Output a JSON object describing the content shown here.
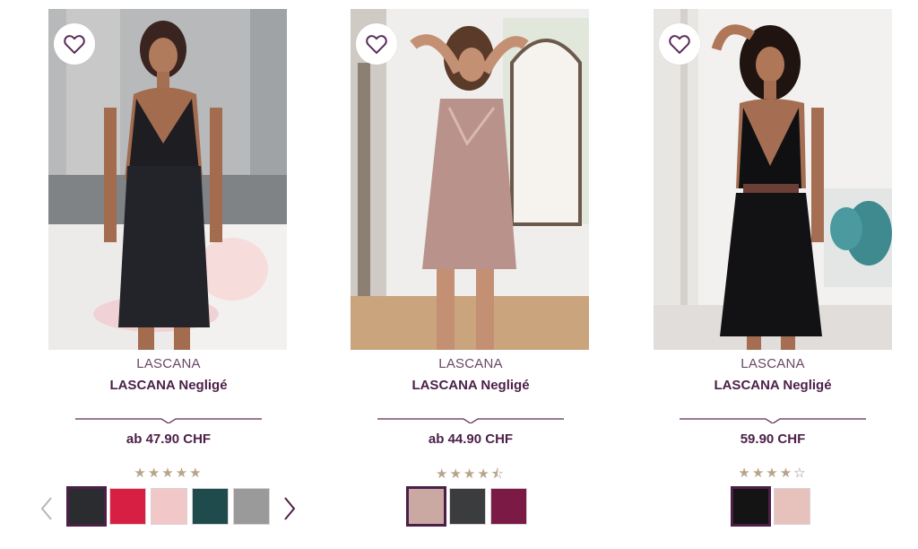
{
  "products": [
    {
      "brand": "LASCANA",
      "title": "LASCANA Negligé",
      "price": "ab 47.90 CHF",
      "rating_stars": "★★★★★",
      "rating_empty": "",
      "swatches": [
        "#2b2c30",
        "#d61f43",
        "#f1c7c7",
        "#1f4b4c",
        "#9a9a9a"
      ],
      "selected_swatch": 0,
      "has_prev_arrow": true,
      "has_next_arrow": true
    },
    {
      "brand": "LASCANA",
      "title": "LASCANA Negligé",
      "price": "ab 44.90 CHF",
      "rating_stars": "★★★★⯪",
      "rating_empty": "",
      "swatches": [
        "#c9a9a2",
        "#3b3c3e",
        "#7b1a45"
      ],
      "selected_swatch": 0
    },
    {
      "brand": "LASCANA",
      "title": "LASCANA Negligé",
      "price": "59.90 CHF",
      "rating_stars": "★★★★",
      "rating_empty": "☆",
      "swatches": [
        "#141414",
        "#e7c2bd"
      ],
      "selected_swatch": 0
    }
  ],
  "icons": {
    "favorite": "heart-outline-icon",
    "prev": "chevron-left-icon",
    "next": "chevron-right-icon"
  },
  "colors": {
    "accent": "#5a2a55",
    "star": "#b8a48a"
  }
}
